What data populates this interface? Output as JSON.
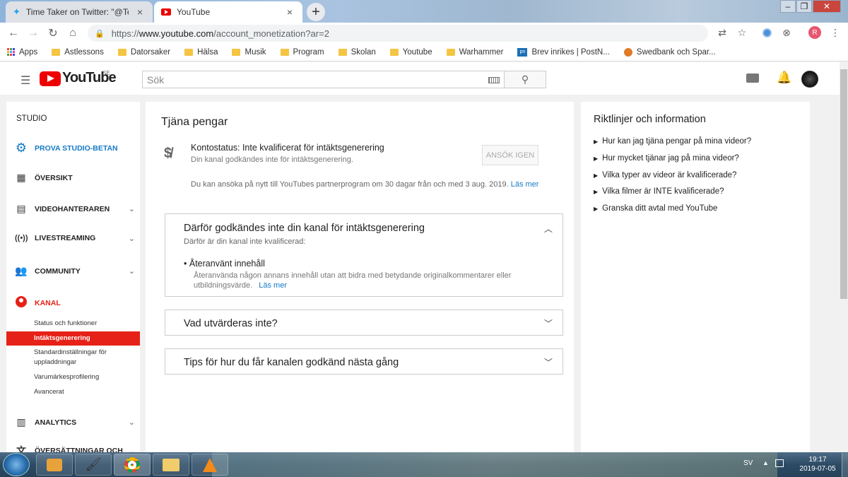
{
  "browser": {
    "tabs": [
      {
        "title": "Time Taker on Twitter: \"@TeamY",
        "icon": "twitter-icon"
      },
      {
        "title": "YouTube",
        "icon": "youtube-icon"
      }
    ],
    "url_scheme": "https://",
    "url_domain": "www.youtube.com",
    "url_path": "/account_monetization?ar=2",
    "profile_initial": "R",
    "bookmarks": [
      {
        "label": "Apps",
        "icon": "apps-icon"
      },
      {
        "label": "Astlessons",
        "icon": "folder-icon"
      },
      {
        "label": "Datorsaker",
        "icon": "folder-icon"
      },
      {
        "label": "Hälsa",
        "icon": "folder-icon"
      },
      {
        "label": "Musik",
        "icon": "folder-icon"
      },
      {
        "label": "Program",
        "icon": "folder-icon"
      },
      {
        "label": "Skolan",
        "icon": "folder-icon"
      },
      {
        "label": "Youtube",
        "icon": "folder-icon"
      },
      {
        "label": "Warhammer",
        "icon": "folder-icon"
      },
      {
        "label": "Brev inrikes | PostN...",
        "icon": "postnord-icon"
      },
      {
        "label": "Swedbank och Spar...",
        "icon": "swedbank-icon"
      }
    ]
  },
  "header": {
    "logo_text": "YouTube",
    "region": "SE",
    "search_placeholder": "Sök"
  },
  "sidebar": {
    "studio_label": "STUDIO",
    "items": [
      {
        "label": "PROVA STUDIO-BETAN",
        "icon": "gear-icon"
      },
      {
        "label": "ÖVERSIKT",
        "icon": "dashboard-icon"
      },
      {
        "label": "VIDEOHANTERAREN",
        "icon": "video-manager-icon"
      },
      {
        "label": "LIVESTREAMING",
        "icon": "live-icon"
      },
      {
        "label": "COMMUNITY",
        "icon": "community-icon"
      },
      {
        "label": "KANAL",
        "icon": "account-icon"
      },
      {
        "label": "ANALYTICS",
        "icon": "bar-chart-icon"
      },
      {
        "label": "ÖVERSÄTTNINGAR OCH",
        "icon": "translate-icon"
      }
    ],
    "kanal_sub": [
      "Status och funktioner",
      "Intäktsgenerering",
      "Standardinställningar för",
      "uppladdningar",
      "Varumärkesprofilering",
      "Avancerat"
    ]
  },
  "main": {
    "title": "Tjäna pengar",
    "status_title": "Kontostatus: Inte kvalificerat för intäktsgenerering",
    "status_sub": "Din kanal godkändes inte för intäktsgenerering.",
    "apply_button": "ANSÖK IGEN",
    "reapply_text": "Du kan ansöka på nytt till YouTubes partnerprogram om 30 dagar från och med 3 aug. 2019.",
    "learn_more": "Läs mer",
    "reason_header": "Därför godkändes inte din kanal för intäktsgenerering",
    "reason_sub": "Därför är din kanal inte kvalificerad:",
    "reason_item_title": "Återanvänt innehåll",
    "reason_item_line1": "Återanvända någon annans innehåll utan att bidra med betydande originalkommentarer eller",
    "reason_item_line2": "utbildningsvärde.",
    "reason_learn_more": "Läs mer",
    "not_evaluated_header": "Vad utvärderas inte?",
    "tips_header": "Tips för hur du får kanalen godkänd nästa gång"
  },
  "right": {
    "title": "Riktlinjer och information",
    "links": [
      "Hur kan jag tjäna pengar på mina videor?",
      "Hur mycket tjänar jag på mina videor?",
      "Vilka typer av videor är kvalificerade?",
      "Vilka filmer är INTE kvalificerade?",
      "Granska ditt avtal med YouTube"
    ]
  },
  "taskbar": {
    "language": "SV",
    "time": "19:17",
    "date": "2019-07-05"
  },
  "colors": {
    "youtube_red": "#e00000",
    "link_blue": "#167ac6",
    "active_sub_bg": "#e62117"
  }
}
